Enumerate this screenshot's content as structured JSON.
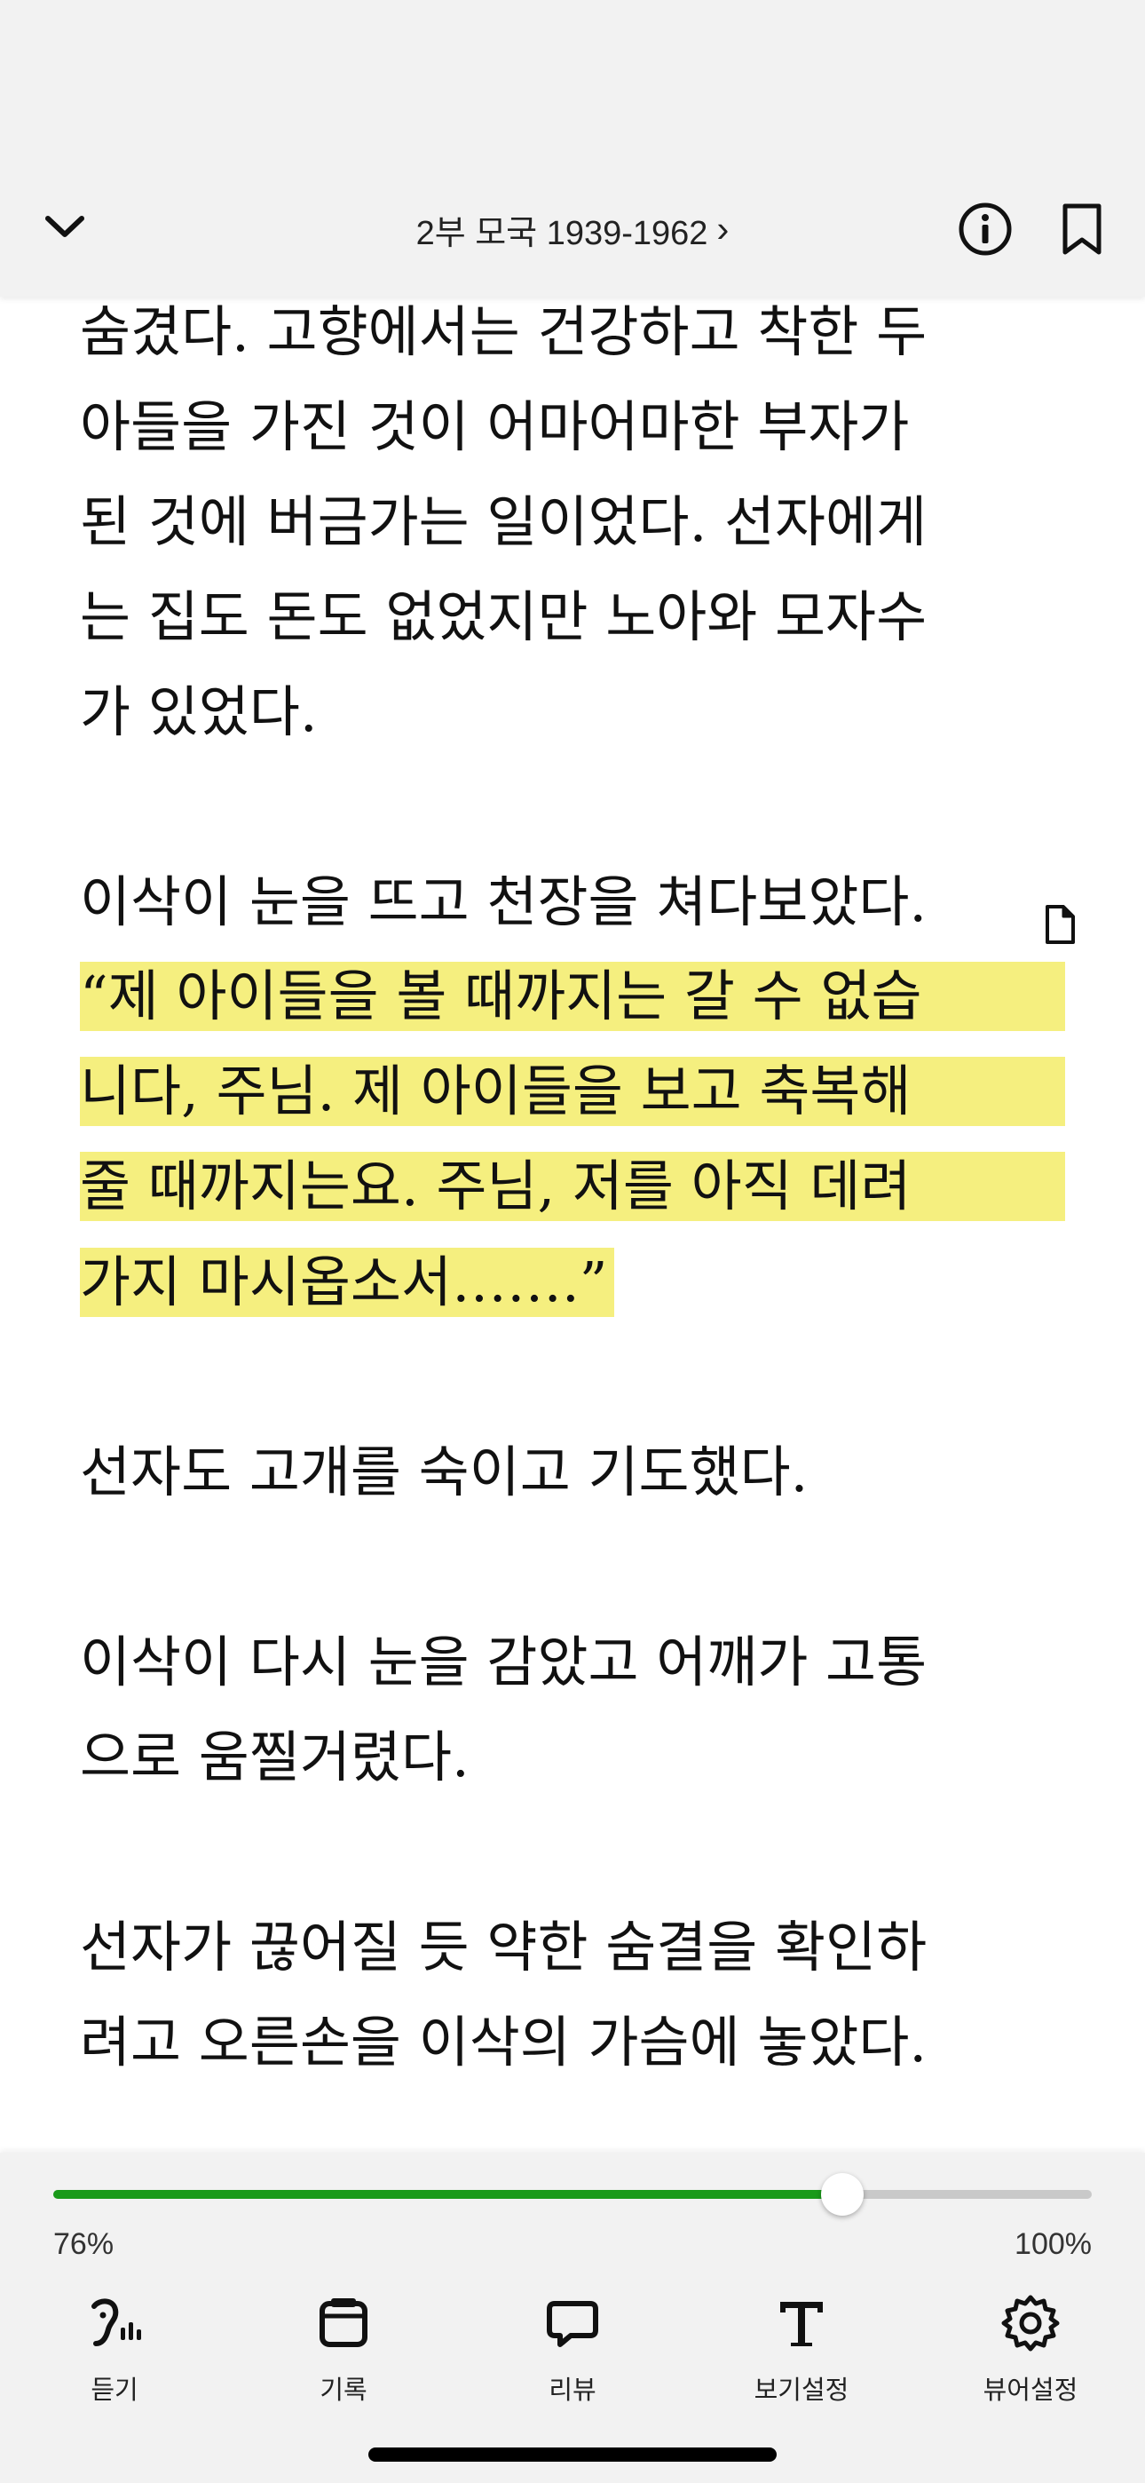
{
  "header": {
    "chapter_title": "2부 모국 1939-1962",
    "chevron": "›",
    "back_icon": "chevron-down-icon",
    "info_icon": "info-icon",
    "bookmark_icon": "bookmark-icon"
  },
  "content": {
    "lines": [
      "숨겼다. 고향에서는 건강하고 착한 두",
      "아들을 가진 것이 어마어마한 부자가",
      "된 것에 버금가는 일이었다. 선자에게",
      "는 집도 돈도 없었지만 노아와 모자수",
      "가 있었다.",
      "이삭이 눈을 뜨고 천장을 쳐다보았다.",
      "“제 아이들을 볼 때까지는 갈 수 없습",
      "니다, 주님. 제 아이들을 보고 축복해",
      "줄 때까지는요. 주님, 저를 아직 데려",
      "가지 마시옵소서…….”",
      "선자도 고개를 숙이고 기도했다.",
      "이삭이 다시 눈을 감았고 어깨가 고통",
      "으로 움찔거렸다.",
      "선자가 끊어질 듯 약한 숨결을 확인하",
      "려고 오른손을 이삭의 가슴에 놓았다."
    ],
    "highlight_color": "#f5ef7f"
  },
  "progress": {
    "current_label": "76%",
    "end_label": "100%",
    "value": 0.76,
    "fill_color": "#1a9a1a"
  },
  "toolbar": {
    "items": [
      {
        "label": "듣기",
        "icon": "listen-icon"
      },
      {
        "label": "기록",
        "icon": "record-icon"
      },
      {
        "label": "리뷰",
        "icon": "review-icon"
      },
      {
        "label": "보기설정",
        "icon": "text-settings-icon"
      },
      {
        "label": "뷰어설정",
        "icon": "gear-icon"
      }
    ]
  }
}
